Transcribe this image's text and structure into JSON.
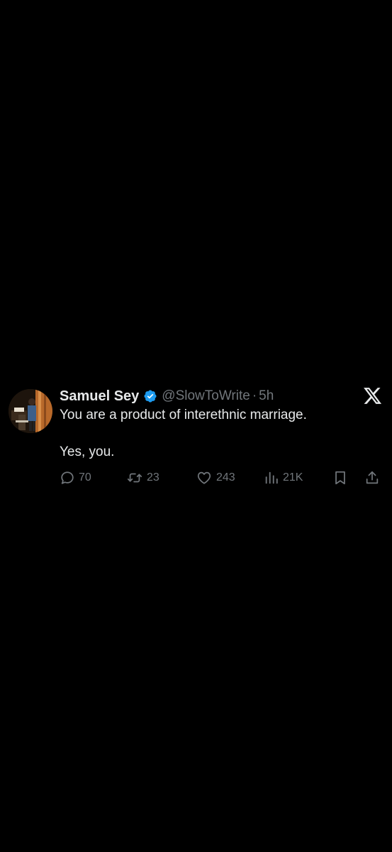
{
  "tweet": {
    "author_name": "Samuel Sey",
    "verified": true,
    "handle": "@SlowToWrite",
    "separator": "·",
    "time": "5h",
    "text_line1": "You are a product of interethnic marriage.",
    "text_line2": "Yes, you.",
    "stats": {
      "replies": "70",
      "retweets": "23",
      "likes": "243",
      "views": "21K"
    }
  },
  "icons": {
    "verified": "verified-badge-icon",
    "brand": "x-logo-icon",
    "reply": "reply-icon",
    "retweet": "retweet-icon",
    "like": "heart-icon",
    "views": "views-bar-chart-icon",
    "bookmark": "bookmark-icon",
    "share": "share-icon"
  },
  "colors": {
    "background": "#000000",
    "primary_text": "#e7e9ea",
    "secondary_text": "#71767b",
    "verified_blue": "#1d9bf0"
  }
}
